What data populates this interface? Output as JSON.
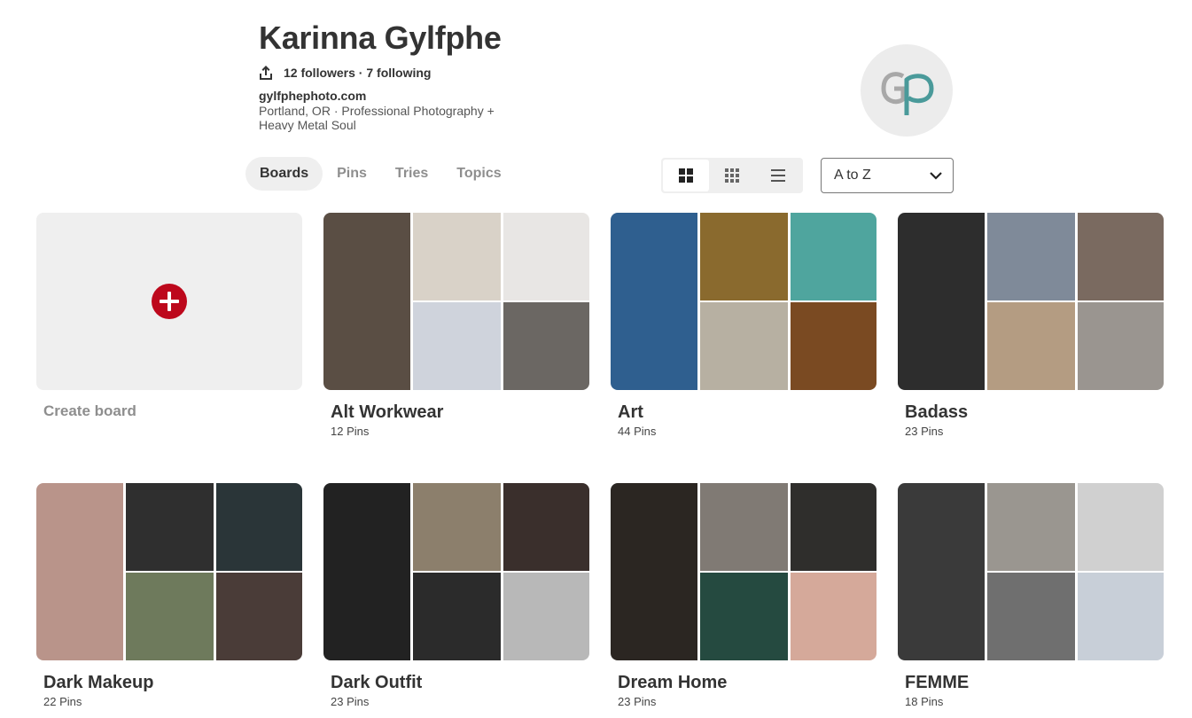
{
  "profile": {
    "name": "Karinna Gylfphe",
    "stats": "12 followers · 7 following",
    "website": "gylfphephoto.com",
    "about_line1": "Portland, OR  ·  Professional Photography +",
    "about_line2": "Heavy Metal Soul",
    "avatar_monogram": "gp"
  },
  "tabs": [
    {
      "label": "Boards",
      "active": true
    },
    {
      "label": "Pins",
      "active": false
    },
    {
      "label": "Tries",
      "active": false
    },
    {
      "label": "Topics",
      "active": false
    }
  ],
  "view_options": [
    {
      "icon": "large-grid-icon",
      "active": true
    },
    {
      "icon": "small-grid-icon",
      "active": false
    },
    {
      "icon": "list-view-icon",
      "active": false
    }
  ],
  "sort": {
    "selected": "A to Z",
    "icon": "chevron-down-icon"
  },
  "create_board": {
    "label": "Create board",
    "icon": "plus-circle-icon",
    "icon_color": "#bd081c"
  },
  "boards": [
    {
      "title": "Alt Workwear",
      "count": "12 Pins",
      "colors": [
        "#d9d2c8",
        "#5a4e44",
        "#e8e6e4",
        "#cfd3dc",
        "#6b6763"
      ]
    },
    {
      "title": "Art",
      "count": "44 Pins",
      "colors": [
        "#8a6a2e",
        "#2f5f8f",
        "#4fa59e",
        "#b7b0a2",
        "#7a4a22"
      ]
    },
    {
      "title": "Badass",
      "count": "23 Pins",
      "colors": [
        "#7f8a99",
        "#2d2d2d",
        "#7a6a60",
        "#b49c82",
        "#9a9590"
      ]
    },
    {
      "title": "Dark Makeup",
      "count": "22 Pins",
      "colors": [
        "#2f2f2f",
        "#b9948a",
        "#2a3538",
        "#6e7a5c",
        "#4a3c38"
      ]
    },
    {
      "title": "Dark Outfit",
      "count": "23 Pins",
      "colors": [
        "#8c7f6c",
        "#222222",
        "#3a2f2c",
        "#2b2b2b",
        "#b8b8b8"
      ]
    },
    {
      "title": "Dream Home",
      "count": "23 Pins",
      "colors": [
        "#807a74",
        "#2b2622",
        "#2f2e2c",
        "#254a40",
        "#d5a99a"
      ]
    },
    {
      "title": "FEMME",
      "count": "18 Pins",
      "colors": [
        "#9a9690",
        "#3a3a3a",
        "#d0d0d0",
        "#6f6f6f",
        "#c8cfd8"
      ]
    }
  ],
  "brand_colors": {
    "accent": "#bd081c",
    "logo_teal": "#4a9a9a",
    "logo_gray": "#a8a8a8"
  }
}
